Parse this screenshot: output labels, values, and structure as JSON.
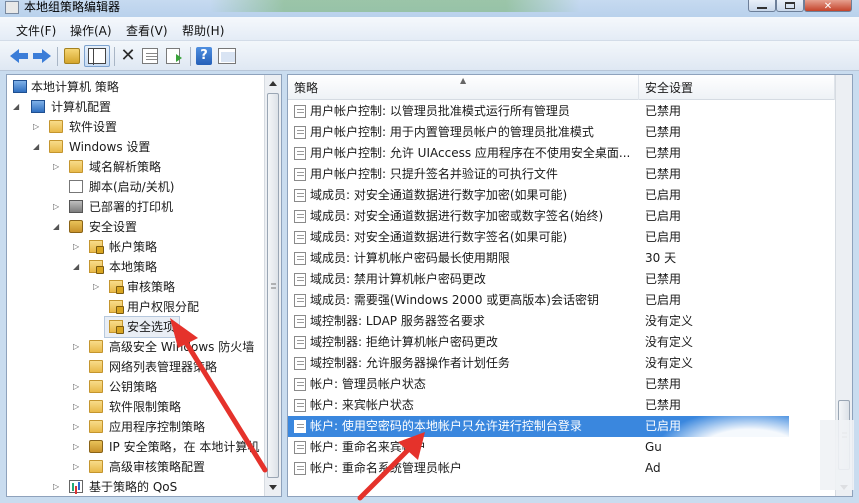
{
  "window": {
    "title": "本地组策略编辑器",
    "close_glyph": "✕"
  },
  "menu": [
    {
      "label": "文件(F)"
    },
    {
      "label": "操作(A)"
    },
    {
      "label": "查看(V)"
    },
    {
      "label": "帮助(H)"
    }
  ],
  "toolbar": {
    "icons": [
      "back-arrow-icon",
      "forward-arrow-icon",
      "up-folder-icon",
      "show-hide-tree-icon",
      "delete-icon",
      "properties-icon",
      "export-list-icon",
      "help-icon",
      "console-pane-icon"
    ],
    "help_glyph": "?",
    "delete_glyph": "✕"
  },
  "tree": {
    "items": [
      {
        "label": "本地计算机 策略",
        "expander": "",
        "icon": "computer"
      },
      {
        "label": "计算机配置",
        "expander": "◢",
        "icon": "computer"
      },
      {
        "label": "软件设置",
        "expander": "▷",
        "icon": "folder"
      },
      {
        "label": "Windows 设置",
        "expander": "◢",
        "icon": "folder"
      },
      {
        "label": "域名解析策略",
        "expander": "▷",
        "icon": "folder"
      },
      {
        "label": "脚本(启动/关机)",
        "expander": "",
        "icon": "doc"
      },
      {
        "label": "已部署的打印机",
        "expander": "▷",
        "icon": "printer"
      },
      {
        "label": "安全设置",
        "expander": "◢",
        "icon": "shield"
      },
      {
        "label": "帐户策略",
        "expander": "▷",
        "icon": "folder-lock"
      },
      {
        "label": "本地策略",
        "expander": "◢",
        "icon": "folder-lock"
      },
      {
        "label": "审核策略",
        "expander": "▷",
        "icon": "folder-lock"
      },
      {
        "label": "用户权限分配",
        "expander": "",
        "icon": "folder-lock"
      },
      {
        "label": "安全选项",
        "expander": "",
        "icon": "folder-lock"
      },
      {
        "label": "高级安全 Windows 防火墙",
        "expander": "▷",
        "icon": "folder"
      },
      {
        "label": "网络列表管理器策略",
        "expander": "",
        "icon": "folder"
      },
      {
        "label": "公钥策略",
        "expander": "▷",
        "icon": "folder"
      },
      {
        "label": "软件限制策略",
        "expander": "▷",
        "icon": "folder"
      },
      {
        "label": "应用程序控制策略",
        "expander": "▷",
        "icon": "folder"
      },
      {
        "label": "IP 安全策略，在 本地计算机",
        "expander": "▷",
        "icon": "shield"
      },
      {
        "label": "高级审核策略配置",
        "expander": "▷",
        "icon": "folder"
      },
      {
        "label": "基于策略的 QoS",
        "expander": "▷",
        "icon": "chart"
      }
    ]
  },
  "list": {
    "columns": {
      "policy": "策略",
      "setting": "安全设置"
    },
    "rows": [
      {
        "policy": "用户帐户控制: 以管理员批准模式运行所有管理员",
        "setting": "已禁用"
      },
      {
        "policy": "用户帐户控制: 用于内置管理员帐户的管理员批准模式",
        "setting": "已禁用"
      },
      {
        "policy": "用户帐户控制: 允许 UIAccess 应用程序在不使用安全桌面...",
        "setting": "已禁用"
      },
      {
        "policy": "用户帐户控制: 只提升签名并验证的可执行文件",
        "setting": "已禁用"
      },
      {
        "policy": "域成员: 对安全通道数据进行数字加密(如果可能)",
        "setting": "已启用"
      },
      {
        "policy": "域成员: 对安全通道数据进行数字加密或数字签名(始终)",
        "setting": "已启用"
      },
      {
        "policy": "域成员: 对安全通道数据进行数字签名(如果可能)",
        "setting": "已启用"
      },
      {
        "policy": "域成员: 计算机帐户密码最长使用期限",
        "setting": "30 天"
      },
      {
        "policy": "域成员: 禁用计算机帐户密码更改",
        "setting": "已禁用"
      },
      {
        "policy": "域成员: 需要强(Windows 2000 或更高版本)会话密钥",
        "setting": "已启用"
      },
      {
        "policy": "域控制器: LDAP 服务器签名要求",
        "setting": "没有定义"
      },
      {
        "policy": "域控制器: 拒绝计算机帐户密码更改",
        "setting": "没有定义"
      },
      {
        "policy": "域控制器: 允许服务器操作者计划任务",
        "setting": "没有定义"
      },
      {
        "policy": "帐户: 管理员帐户状态",
        "setting": "已禁用"
      },
      {
        "policy": "帐户: 来宾帐户状态",
        "setting": "已禁用"
      },
      {
        "policy": "帐户: 使用空密码的本地帐户只允许进行控制台登录",
        "setting": "已启用"
      },
      {
        "policy": "帐户: 重命名来宾帐户",
        "setting": "Gu"
      },
      {
        "policy": "帐户: 重命名系统管理员帐户",
        "setting": "Ad"
      }
    ]
  },
  "colors": {
    "selection": "#3a87de",
    "annotation_arrow": "#e5322b"
  }
}
